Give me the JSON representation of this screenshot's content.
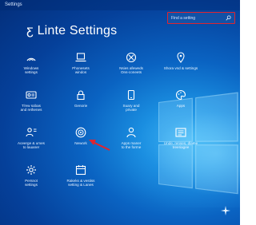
{
  "window": {
    "title": "Settings"
  },
  "header": {
    "title": "ƹ Linte Settings"
  },
  "search": {
    "placeholder": "Find a setting"
  },
  "tiles": [
    {
      "label": "Windows\nsettings",
      "icon": "arc-icon"
    },
    {
      "label": "Phonesets\nwindos",
      "icon": "laptop-icon"
    },
    {
      "label": "Nsies afeweds\nOns-coneets",
      "icon": "xbox-icon"
    },
    {
      "label": "Shora vnd & settings",
      "icon": "location-pin-icon"
    },
    {
      "label": "Ti'ew sobas\nand rethenes",
      "icon": "card-icon"
    },
    {
      "label": "Genorie",
      "icon": "lock-icon"
    },
    {
      "label": "Suary and\nprivate",
      "icon": "tablet-icon"
    },
    {
      "label": "Apps",
      "icon": "palette-icon"
    },
    {
      "label": "Aceerge & umes\nto lauaner",
      "icon": "person-board-icon"
    },
    {
      "label": "Nework",
      "icon": "accessibility-icon"
    },
    {
      "label": "Apps maner\nto the forme",
      "icon": "person-icon"
    },
    {
      "label": "Unde, renses, dlame\ntreeriagee",
      "icon": "list-card-icon"
    },
    {
      "label": "Persnot\nsettings",
      "icon": "gear-icon"
    },
    {
      "label": "Rakeks & vestiss\nsetting & Lanes",
      "icon": "calendar-icon"
    }
  ],
  "colors": {
    "accent": "#e0242f",
    "background": "#0a63c2"
  }
}
